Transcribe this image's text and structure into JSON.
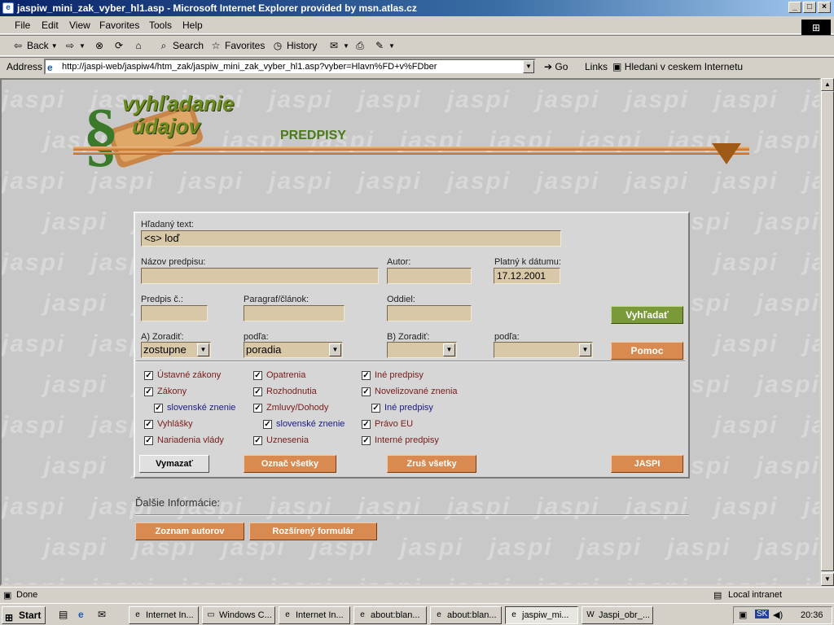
{
  "window": {
    "title": "jaspiw_mini_zak_vyber_hl1.asp - Microsoft Internet Explorer provided by msn.atlas.cz"
  },
  "menu": [
    "File",
    "Edit",
    "View",
    "Favorites",
    "Tools",
    "Help"
  ],
  "toolbar": {
    "back": "Back",
    "search": "Search",
    "favorites": "Favorites",
    "history": "History"
  },
  "address": {
    "label": "Address",
    "url": "http://jaspi-web/jaspiw4/htm_zak/jaspiw_mini_zak_vyber_hl1.asp?vyber=Hlavn%FD+v%FDber",
    "go": "Go",
    "links": "Links",
    "link1": "Hledani v ceskem Internetu"
  },
  "banner": {
    "title_line1": "vyhľadanie",
    "title_line2": "údajov",
    "section": "PREDPISY"
  },
  "watermark": "jaspi",
  "form": {
    "search_label": "Hľadaný text:",
    "search_value": "<s> loď",
    "name_label": "Názov predpisu:",
    "name_value": "",
    "author_label": "Autor:",
    "author_value": "",
    "valid_label": "Platný k dátumu:",
    "valid_value": "17.12.2001",
    "number_label": "Predpis č.:",
    "number_value": "",
    "para_label": "Paragraf/článok:",
    "para_value": "",
    "section_label": "Oddiel:",
    "section_value": "",
    "search_button": "Vyhľadať",
    "sortA_label": "A) Zoradiť:",
    "sortA_value": "zostupne",
    "byA_label": "podľa:",
    "byA_value": "poradia",
    "sortB_label": "B) Zoradiť:",
    "sortB_value": "",
    "byB_label": "podľa:",
    "byB_value": "",
    "help_button": "Pomoc",
    "checkboxes": [
      {
        "label": "Ústavné zákony",
        "checked": true
      },
      {
        "label": "Zákony",
        "checked": true
      },
      {
        "label": "slovenské znenie",
        "checked": true
      },
      {
        "label": "Vyhlášky",
        "checked": true
      },
      {
        "label": "Nariadenia vlády",
        "checked": true
      },
      {
        "label": "Opatrenia",
        "checked": true
      },
      {
        "label": "Rozhodnutia",
        "checked": true
      },
      {
        "label": "Zmluvy/Dohody",
        "checked": true
      },
      {
        "label": "slovenské znenie",
        "checked": true
      },
      {
        "label": "Uznesenia",
        "checked": true
      },
      {
        "label": "Iné predpisy",
        "checked": true
      },
      {
        "label": "Novelizované znenia",
        "checked": true
      },
      {
        "label": "Iné predpisy",
        "checked": true
      },
      {
        "label": "Právo EU",
        "checked": true
      },
      {
        "label": "Interné predpisy",
        "checked": true
      }
    ],
    "clear_button": "Vymazať",
    "mark_all_button": "Označ všetky",
    "unmark_all_button": "Zruš všetky",
    "jaspi_button": "JASPI"
  },
  "more": {
    "label": "Ďalšie Informácie:",
    "authors_button": "Zoznam autorov",
    "extended_button": "Rozšírený formulár"
  },
  "status": {
    "left": "Done",
    "zone": "Local intranet"
  },
  "taskbar": {
    "start": "Start",
    "tasks": [
      "Internet In...",
      "Windows C...",
      "Internet In...",
      "about:blan...",
      "about:blan...",
      "jaspiw_mi...",
      "Jaspi_obr_..."
    ],
    "lang": "SK",
    "clock": "20:36"
  },
  "colors": {
    "title_bar": "#0a246a",
    "button_green": "#7a9a3a",
    "button_orange": "#d88a50",
    "field": "#d8c8a8",
    "banner_green": "#6b8c1e"
  }
}
